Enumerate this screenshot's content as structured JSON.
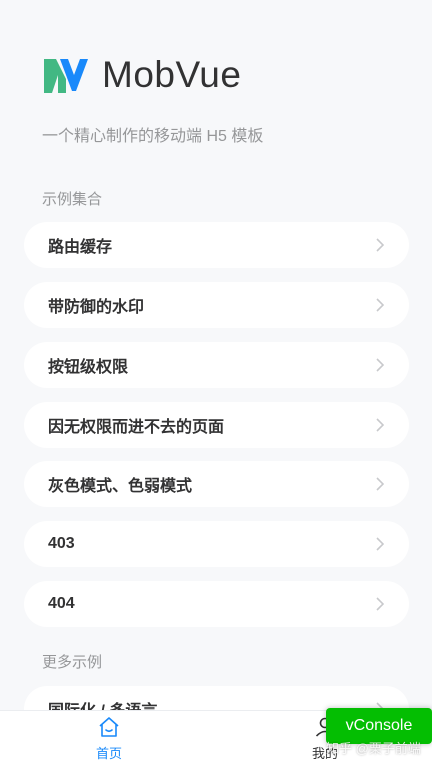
{
  "header": {
    "title": "MobVue"
  },
  "subtitle": "一个精心制作的移动端 H5 模板",
  "sections": [
    {
      "title": "示例集合"
    },
    {
      "title": "更多示例"
    }
  ],
  "examples": [
    {
      "label": "路由缓存"
    },
    {
      "label": "带防御的水印"
    },
    {
      "label": "按钮级权限"
    },
    {
      "label": "因无权限而进不去的页面"
    },
    {
      "label": "灰色模式、色弱模式"
    },
    {
      "label": "403"
    },
    {
      "label": "404"
    }
  ],
  "more_examples": [
    {
      "label": "国际化 / 多语言"
    }
  ],
  "tabbar": {
    "home_label": "首页",
    "mine_label": "我的"
  },
  "vconsole": {
    "label": "vConsole"
  },
  "watermark": "知乎 @栗子前端",
  "colors": {
    "accent": "#1989fa",
    "logo_green": "#42b883",
    "logo_blue": "#1989fa",
    "vconsole_green": "#04be02"
  },
  "icons": {
    "logo": "mobvue-logo",
    "chevron": "chevron-right-icon",
    "home": "home-icon",
    "mine": "user-icon"
  }
}
